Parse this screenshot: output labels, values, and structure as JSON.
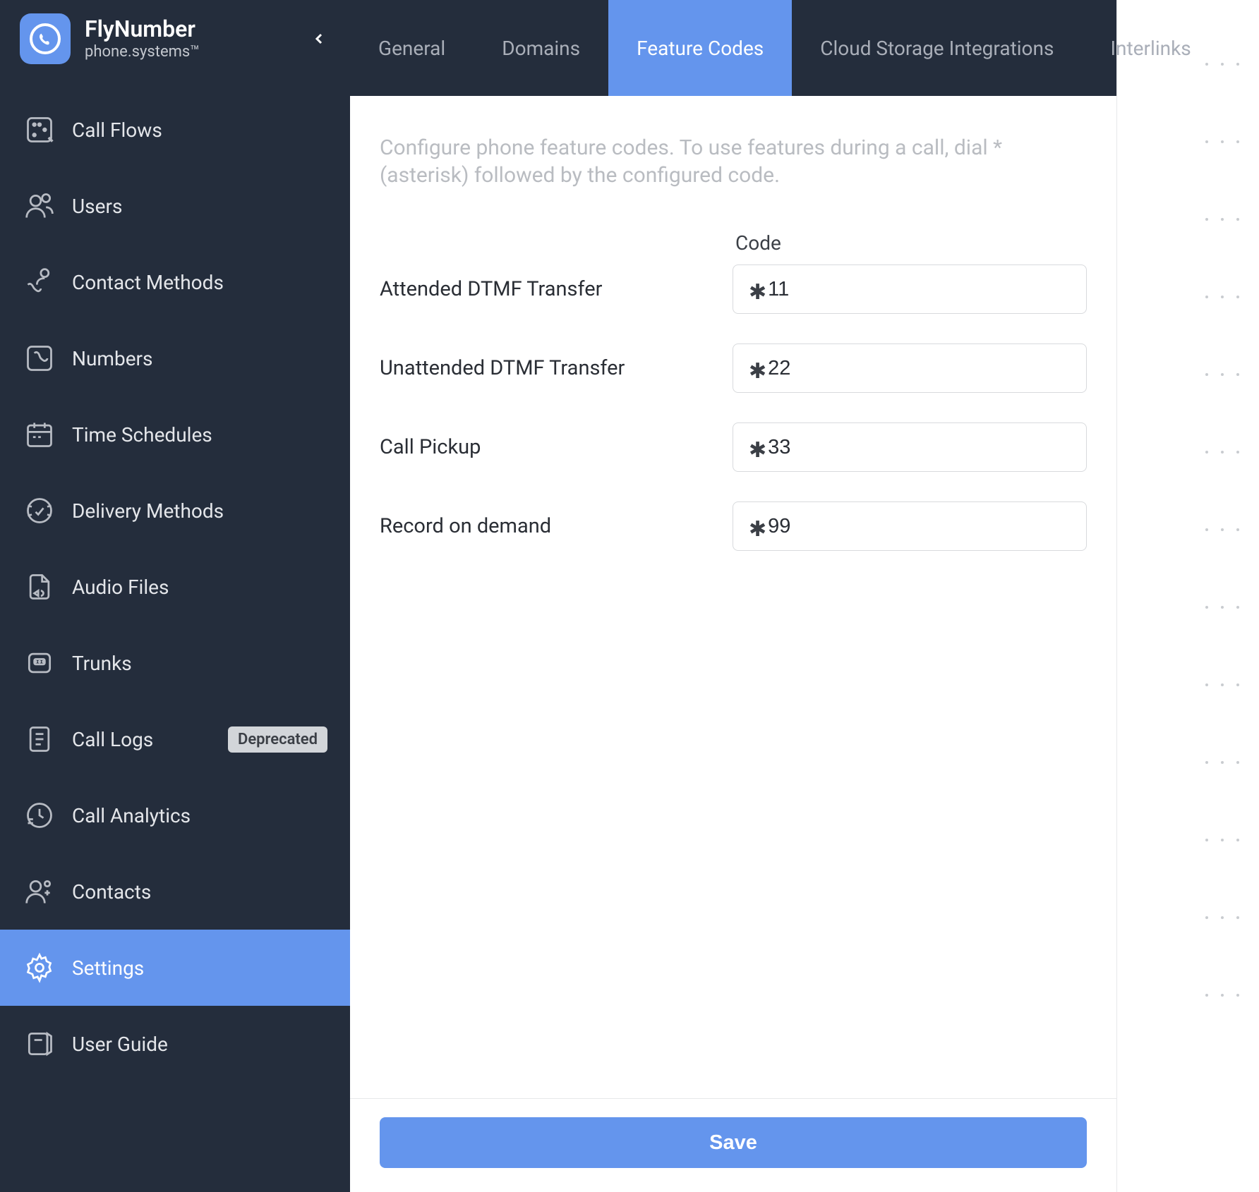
{
  "brand": {
    "title": "FlyNumber",
    "subtitle": "phone.systems™"
  },
  "sidebar": {
    "items": [
      {
        "id": "call-flows",
        "label": "Call Flows"
      },
      {
        "id": "users",
        "label": "Users"
      },
      {
        "id": "contact-methods",
        "label": "Contact Methods"
      },
      {
        "id": "numbers",
        "label": "Numbers"
      },
      {
        "id": "time-schedules",
        "label": "Time Schedules"
      },
      {
        "id": "delivery-methods",
        "label": "Delivery Methods"
      },
      {
        "id": "audio-files",
        "label": "Audio Files"
      },
      {
        "id": "trunks",
        "label": "Trunks"
      },
      {
        "id": "call-logs",
        "label": "Call Logs",
        "badge": "Deprecated"
      },
      {
        "id": "call-analytics",
        "label": "Call Analytics"
      },
      {
        "id": "contacts",
        "label": "Contacts"
      },
      {
        "id": "settings",
        "label": "Settings",
        "active": true
      }
    ],
    "footer": {
      "label": "User Guide"
    }
  },
  "tabs": [
    {
      "id": "general",
      "label": "General"
    },
    {
      "id": "domains",
      "label": "Domains"
    },
    {
      "id": "feature-codes",
      "label": "Feature Codes",
      "active": true
    },
    {
      "id": "cloud-storage",
      "label": "Cloud Storage Integrations"
    },
    {
      "id": "interlinks",
      "label": "Interlinks"
    }
  ],
  "page": {
    "description": "Configure phone feature codes. To use features during a call, dial *(asterisk) followed by the configured code.",
    "code_header": "Code",
    "rows": [
      {
        "label": "Attended DTMF Transfer",
        "code": "11"
      },
      {
        "label": "Unattended DTMF Transfer",
        "code": "22"
      },
      {
        "label": "Call Pickup",
        "code": "33"
      },
      {
        "label": "Record on demand",
        "code": "99"
      }
    ],
    "save_label": "Save"
  }
}
